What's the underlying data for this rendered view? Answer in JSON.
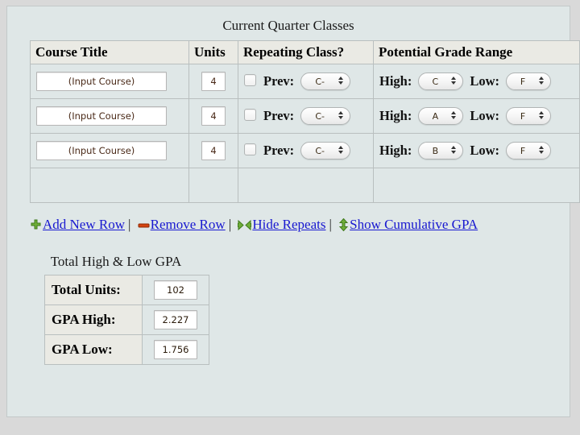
{
  "panel": {
    "background": "#dfe7e7",
    "outer_background": "#d9d9d9"
  },
  "classes_table": {
    "title": "Current Quarter Classes",
    "columns": [
      "Course Title",
      "Units",
      "Repeating Class?",
      "Potential Grade Range"
    ],
    "labels": {
      "prev": "Prev:",
      "high": "High:",
      "low": "Low:"
    },
    "rows": [
      {
        "course_placeholder": "(Input Course)",
        "course_value": "",
        "units": "4",
        "repeating_checked": false,
        "prev_grade": "C-",
        "high_grade": "C",
        "low_grade": "F"
      },
      {
        "course_placeholder": "(Input Course)",
        "course_value": "",
        "units": "4",
        "repeating_checked": false,
        "prev_grade": "C-",
        "high_grade": "A",
        "low_grade": "F"
      },
      {
        "course_placeholder": "(Input Course)",
        "course_value": "",
        "units": "4",
        "repeating_checked": false,
        "prev_grade": "C-",
        "high_grade": "B",
        "low_grade": "F"
      }
    ]
  },
  "actions": {
    "separator": "|",
    "link_color": "#1818d0",
    "items": [
      {
        "label": "Add New Row",
        "icon": "plus-icon",
        "icon_color": "#5a9d30"
      },
      {
        "label": "Remove Row",
        "icon": "minus-icon",
        "icon_color": "#d4430f"
      },
      {
        "label": "Hide Repeats",
        "icon": "collapse-arrows-icon",
        "icon_color": "#5a9d30"
      },
      {
        "label": "Show Cumulative GPA",
        "icon": "vertical-arrows-icon",
        "icon_color": "#6aa832"
      }
    ]
  },
  "totals": {
    "caption": "Total High & Low GPA",
    "rows": [
      {
        "label": "Total Units:",
        "value": "102"
      },
      {
        "label": "GPA High:",
        "value": "2.227"
      },
      {
        "label": "GPA Low:",
        "value": "1.756"
      }
    ]
  }
}
